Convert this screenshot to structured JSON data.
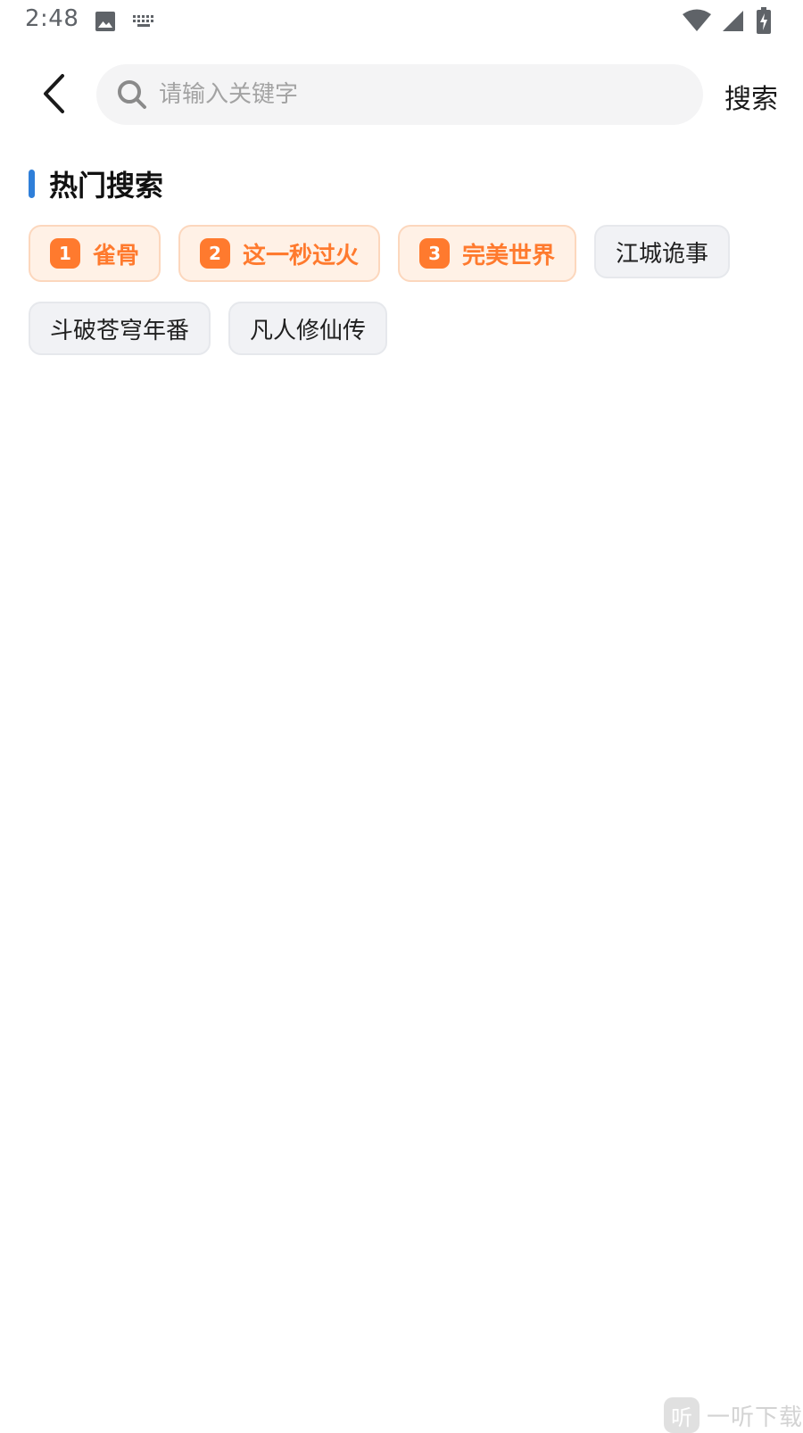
{
  "status_bar": {
    "time": "2:48",
    "icons": [
      "image-icon",
      "keyboard-icon",
      "wifi-icon",
      "signal-icon",
      "battery-charging-icon"
    ]
  },
  "header": {
    "back_icon": "chevron-left-icon",
    "search_icon": "search-icon",
    "search_placeholder": "请输入关键字",
    "search_value": "",
    "search_button_label": "搜索"
  },
  "hot_search": {
    "title": "热门搜索",
    "accent_color": "#2f7fd9",
    "highlight_color": "#ff7a2e",
    "tags": [
      {
        "rank": "1",
        "label": "雀骨"
      },
      {
        "rank": "2",
        "label": "这一秒过火"
      },
      {
        "rank": "3",
        "label": "完美世界"
      },
      {
        "label": "江城诡事"
      },
      {
        "label": "斗破苍穹年番"
      },
      {
        "label": "凡人修仙传"
      }
    ]
  },
  "watermark": {
    "logo_text": "听",
    "text": "一听下载"
  }
}
